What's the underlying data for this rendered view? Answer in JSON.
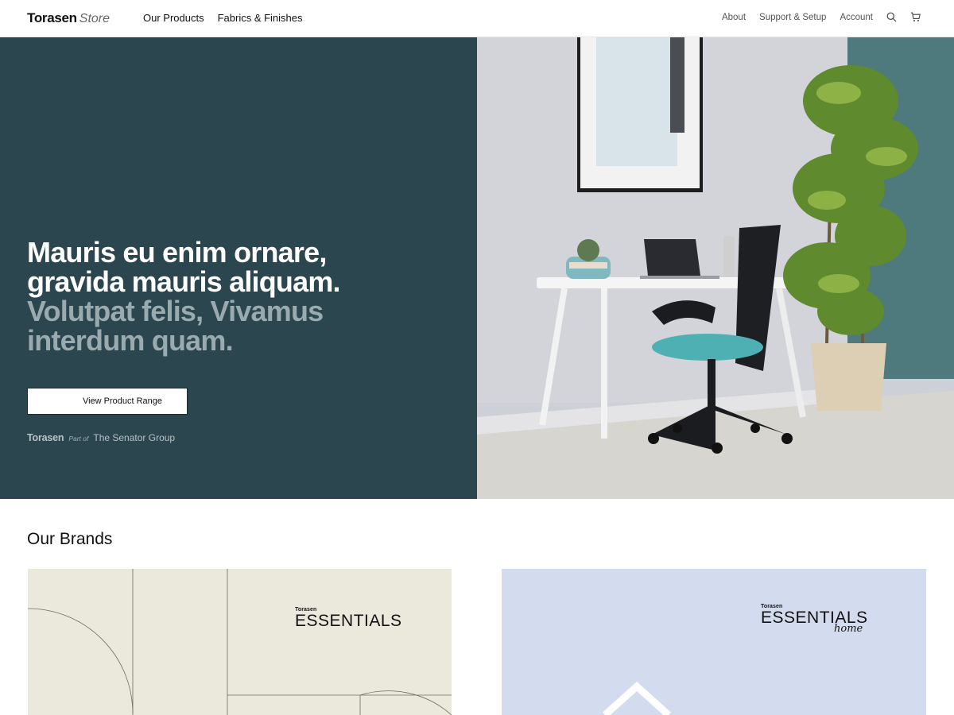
{
  "header": {
    "logo_main": "Torasen",
    "logo_sub": "Store",
    "nav_left": [
      "Our Products",
      "Fabrics & Finishes"
    ],
    "nav_right": [
      "About",
      "Support & Setup",
      "Account"
    ],
    "icons": [
      "search-icon",
      "cart-icon"
    ]
  },
  "hero": {
    "headline_line1": "Mauris eu enim ornare,",
    "headline_line2": "gravida mauris aliquam.",
    "headline_line3": "Volutpat felis, Vivamus",
    "headline_line4": "interdum quam.",
    "cta_label": "View Product Range",
    "group_brand": "Torasen",
    "group_part": "Part of",
    "group_name": "The Senator Group",
    "colors": {
      "panel": "#2b464f",
      "headline": "#ffffff",
      "headline_muted": "#9aabb0"
    }
  },
  "brands": {
    "title": "Our Brands",
    "cards": [
      {
        "small": "Torasen",
        "big": "ESSENTIALS",
        "suffix": "",
        "bg": "#ebe8dc"
      },
      {
        "small": "Torasen",
        "big": "ESSENTIALS",
        "suffix": "home",
        "bg": "#d3dcee"
      }
    ]
  }
}
